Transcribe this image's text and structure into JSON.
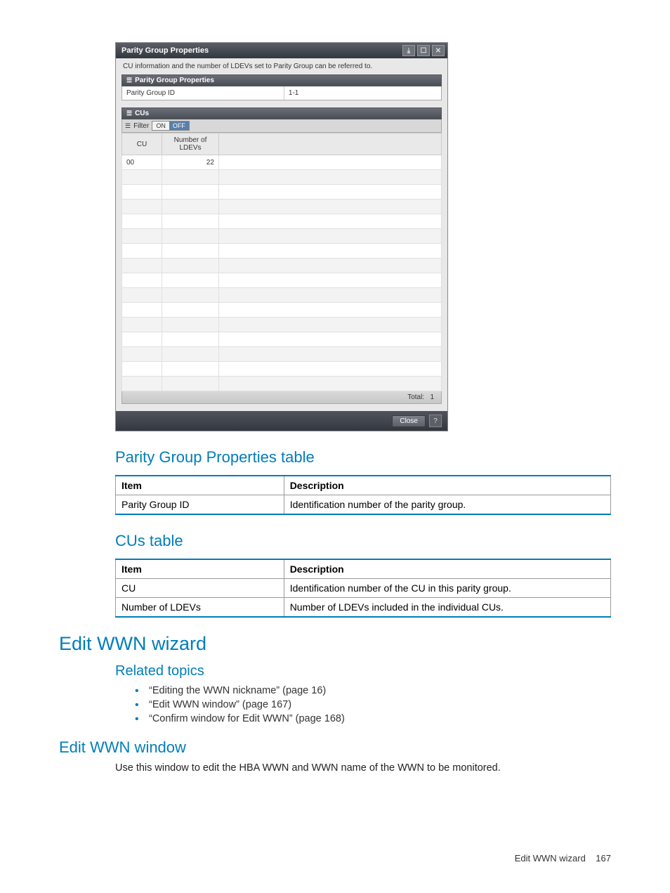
{
  "dialog": {
    "title": "Parity Group Properties",
    "info": "CU information and the number of LDEVs set to Parity Group can be referred to.",
    "section1_title": "Parity Group Properties",
    "pg_id_label": "Parity Group ID",
    "pg_id_value": "1-1",
    "section2_title": "CUs",
    "filter_label": "Filter",
    "on_label": "ON",
    "off_label": "OFF",
    "col_cu": "CU",
    "col_num": "Number of LDEVs",
    "row_cu": "00",
    "row_num": "22",
    "total_label": "Total:",
    "total_value": "1",
    "close_label": "Close"
  },
  "headings": {
    "pgp_table": "Parity Group Properties table",
    "cus_table": "CUs table",
    "edit_wwn_wizard": "Edit WWN wizard",
    "related_topics": "Related topics",
    "edit_wwn_window": "Edit WWN window"
  },
  "pgp_table": {
    "h_item": "Item",
    "h_desc": "Description",
    "r1_item": "Parity Group ID",
    "r1_desc": "Identification number of the parity group."
  },
  "cus_table": {
    "h_item": "Item",
    "h_desc": "Description",
    "r1_item": "CU",
    "r1_desc": "Identification number of the CU in this parity group.",
    "r2_item": "Number of LDEVs",
    "r2_desc": "Number of LDEVs included in the individual CUs."
  },
  "related": {
    "l1": "“Editing the WWN nickname” (page 16)",
    "l2": "“Edit WWN window” (page 167)",
    "l3": "“Confirm window for Edit WWN” (page 168)"
  },
  "body": {
    "edit_wwn_window_desc": "Use this window to edit the HBA WWN and WWN name of the WWN to be monitored."
  },
  "footer": {
    "section": "Edit WWN wizard",
    "page": "167"
  }
}
